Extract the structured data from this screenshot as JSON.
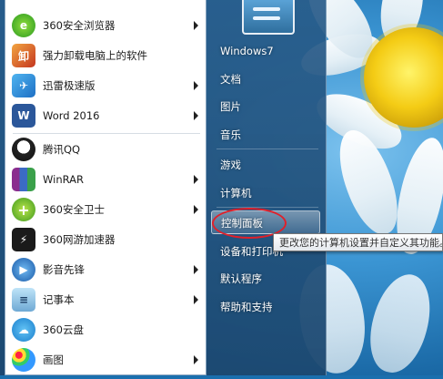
{
  "left_menu": {
    "items": [
      {
        "label": "360安全浏览器",
        "icon": "360-browser-icon",
        "submenu": true
      },
      {
        "label": "强力卸载电脑上的软件",
        "icon": "uninstall-icon",
        "submenu": false
      },
      {
        "label": "迅雷极速版",
        "icon": "thunder-icon",
        "submenu": true
      },
      {
        "label": "Word 2016",
        "icon": "word-icon",
        "submenu": true
      },
      {
        "label": "腾讯QQ",
        "icon": "qq-icon",
        "submenu": false
      },
      {
        "label": "WinRAR",
        "icon": "winrar-icon",
        "submenu": true
      },
      {
        "label": "360安全卫士",
        "icon": "360-safe-icon",
        "submenu": true
      },
      {
        "label": "360网游加速器",
        "icon": "360-game-accelerator-icon",
        "submenu": false
      },
      {
        "label": "影音先锋",
        "icon": "player-icon",
        "submenu": true
      },
      {
        "label": "记事本",
        "icon": "notepad-icon",
        "submenu": true
      },
      {
        "label": "360云盘",
        "icon": "360-cloud-icon",
        "submenu": false
      },
      {
        "label": "画图",
        "icon": "paint-icon",
        "submenu": true
      }
    ]
  },
  "right_menu": {
    "items": [
      {
        "label": "Windows7"
      },
      {
        "label": "文档"
      },
      {
        "label": "图片"
      },
      {
        "label": "音乐"
      },
      {
        "label": "游戏"
      },
      {
        "label": "计算机"
      },
      {
        "label": "控制面板",
        "highlighted": true
      },
      {
        "label": "设备和打印机"
      },
      {
        "label": "默认程序"
      },
      {
        "label": "帮助和支持"
      }
    ]
  },
  "tooltip": {
    "text": "更改您的计算机设置并自定义其功能。"
  },
  "colors": {
    "highlight_ellipse": "#e0202a",
    "menu_blue": "#285c8a"
  }
}
